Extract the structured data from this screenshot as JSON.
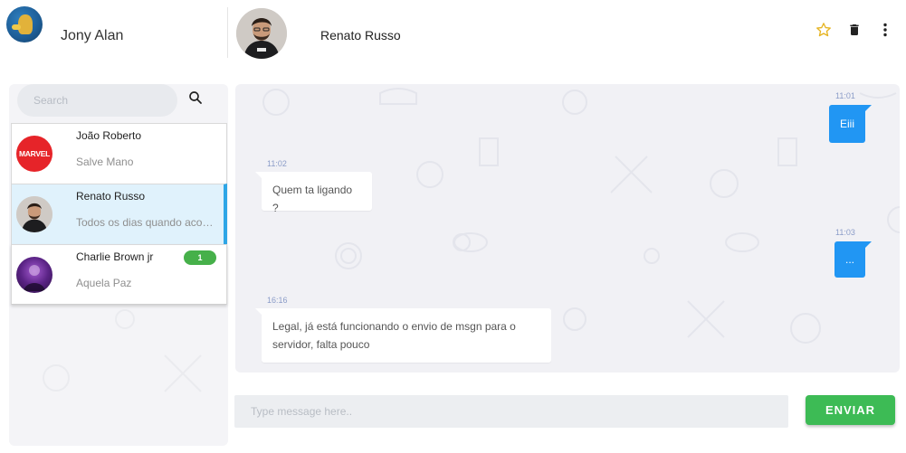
{
  "user": {
    "name": "Jony Alan"
  },
  "header": {
    "contact_name": "Renato Russo",
    "icons": [
      "star-icon",
      "trash-icon",
      "more-vert-icon"
    ],
    "star_color": "#e6b422"
  },
  "sidebar": {
    "search_placeholder": "Search",
    "conversations": [
      {
        "name": "João Roberto",
        "preview": "Salve Mano",
        "avatar": "marvel-logo",
        "avatar_text": "MARVEL",
        "active": false
      },
      {
        "name": "Renato Russo",
        "preview": "Todos os dias quando acordo",
        "avatar": "person-photo",
        "active": true
      },
      {
        "name": "Charlie Brown jr",
        "preview": "Aquela Paz",
        "avatar": "band-photo",
        "unread": "1",
        "active": false
      }
    ]
  },
  "chat": {
    "messages": [
      {
        "direction": "out",
        "time": "11:01",
        "text": "Eiii"
      },
      {
        "direction": "in",
        "time": "11:02",
        "text": "Quem ta ligando ?"
      },
      {
        "direction": "out",
        "time": "11:03",
        "text": "..."
      },
      {
        "direction": "in",
        "time": "16:16",
        "text": "Legal, já está funcionando o envio de msgn para o servidor, falta pouco"
      }
    ]
  },
  "composer": {
    "placeholder": "Type message here..",
    "send_label": "ENVIAR",
    "send_color": "#3dbb55"
  },
  "colors": {
    "accent": "#2196f3",
    "active_item": "#e0f2fc",
    "active_bar": "#2ea6e6",
    "badge": "#46b04a"
  }
}
